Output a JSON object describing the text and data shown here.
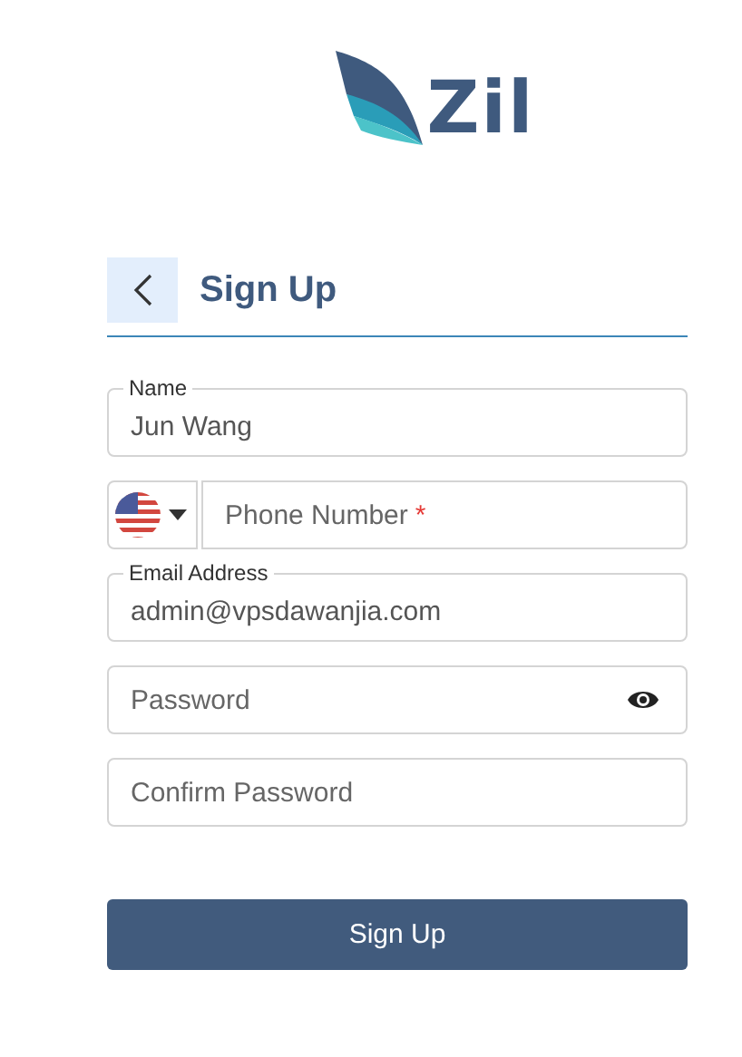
{
  "logo": {
    "text": "Zil"
  },
  "header": {
    "title": "Sign Up"
  },
  "fields": [
    {
      "kind": "labeled",
      "label": "Name",
      "value": "Jun Wang"
    },
    {
      "kind": "phone",
      "placeholder": "Phone Number",
      "required_mark": "*"
    },
    {
      "kind": "labeled",
      "label": "Email Address",
      "value": "admin@vpsdawanjia.com"
    },
    {
      "kind": "password",
      "placeholder": "Password"
    },
    {
      "kind": "plain",
      "placeholder": "Confirm Password"
    }
  ],
  "submit": {
    "label": "Sign Up"
  }
}
